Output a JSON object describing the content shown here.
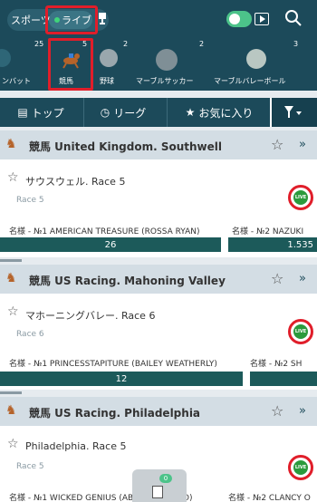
{
  "header": {
    "mode_sports": "スポーツ",
    "mode_live": "ライブ"
  },
  "sports_strip": [
    {
      "label": "ンバット",
      "count": "25",
      "icon": "sword-icon"
    },
    {
      "label": "競馬",
      "count": "5",
      "icon": "horse-icon"
    },
    {
      "label": "野球",
      "count": "2",
      "icon": "baseball-icon"
    },
    {
      "label": "マーブルサッカー",
      "count": "2",
      "icon": "marble-icon"
    },
    {
      "label": "マーブルバレーボール",
      "count": "3",
      "icon": "marble-icon"
    }
  ],
  "nav": {
    "top": "トップ",
    "league": "リーグ",
    "favorites": "お気に入り"
  },
  "sections": [
    {
      "title": "競馬 United Kingdom. Southwell",
      "race_title": "サウスウェル. Race 5",
      "race_sub": "Race 5",
      "odds": [
        {
          "label": "名様 - №1 AMERICAN TREASURE (ROSSA RYAN)",
          "value": "26"
        },
        {
          "label": "名様 - №2 NAZUKI",
          "value": "1.535"
        }
      ]
    },
    {
      "title": "競馬 US Racing. Mahoning Valley",
      "race_title": "マホーニングバレー. Race 6",
      "race_sub": "Race 6",
      "odds": [
        {
          "label": "名様 - №1 PRINCESSTAPITURE (BAILEY WEATHERLY)",
          "value": "12"
        },
        {
          "label": "名様 - №2 SH",
          "value": ""
        }
      ]
    },
    {
      "title": "競馬 US Racing. Philadelphia",
      "race_title": "Philadelphia. Race 5",
      "race_sub": "Race 5",
      "odds": [
        {
          "label": "名様 - №1 WICKED GENIUS (ABNER ADORNO)",
          "value": ""
        },
        {
          "label": "名様 - №2 CLANCY O",
          "value": ""
        }
      ]
    }
  ],
  "live_badge": "LIVE",
  "betslip_count": "0"
}
